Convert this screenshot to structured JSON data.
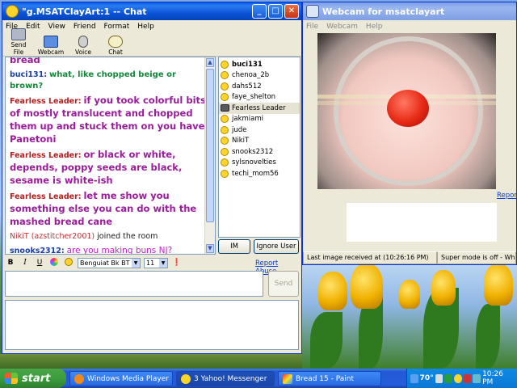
{
  "chat_window": {
    "title": "\"g.MSATClayArt:1 -- Chat",
    "menu": [
      "File",
      "Edit",
      "View",
      "Friend",
      "Format",
      "Help"
    ],
    "toolbar": [
      "Send File",
      "Webcam",
      "Voice",
      "Chat"
    ],
    "messages": [
      {
        "kind": "fl",
        "sender": "",
        "text": "bread"
      },
      {
        "kind": "bu",
        "sender": "buci131:",
        "text": "what, like chopped beige or brown?"
      },
      {
        "kind": "fl",
        "sender": "Fearless Leader:",
        "text": "if you took colorful bits of mostly translucent and chopped them up and stuck them on you have Panetoni"
      },
      {
        "kind": "fl",
        "sender": "Fearless Leader:",
        "text": "or black or white, depends, poppy seeds are black, sesame is white-ish"
      },
      {
        "kind": "fl",
        "sender": "Fearless Leader:",
        "text": "let me show you something else you can do with the mashed bread cane"
      }
    ],
    "join": {
      "name": "NikiT (azstitcher2001)",
      "rest": "joined the room"
    },
    "last_message": {
      "sender": "snooks2312:",
      "text": "are you making buns NJ?"
    },
    "users": [
      "buci131",
      "chenoa_2b",
      "dahs512",
      "faye_shelton",
      "Fearless Leader",
      "jakmiami",
      "jude",
      "NikiT",
      "snooks2312",
      "sylsnovelties",
      "techi_mom56"
    ],
    "selected_user": "Fearless Leader",
    "buttons": {
      "im": "IM",
      "ignore": "Ignore User",
      "send": "Send"
    },
    "format": {
      "bold": "B",
      "italic": "I",
      "underline": "U",
      "font": "Benguiat Bk BT",
      "size": "11"
    },
    "report_abuse": "Report Abuse"
  },
  "webcam_window": {
    "title": "Webcam for msatclayart",
    "menu": [
      "File",
      "Webcam",
      "Help"
    ],
    "report": "Report",
    "last_image": "Last image received at (10:26:16 PM)",
    "super_mode": "Super mode is off - What's"
  },
  "taskbar": {
    "start": "start",
    "tasks": [
      "Windows Media Player",
      "3 Yahoo! Messenger",
      "Bread 15 - Paint"
    ],
    "temp": "70°",
    "clock": "10:26 PM"
  },
  "colors": {
    "xp_blue": "#0a5fe6",
    "fearless_leader": "#b81d1d",
    "fl_text": "#9b1c9b",
    "buci_text": "#14873a",
    "snooks_text": "#c21ecb"
  }
}
